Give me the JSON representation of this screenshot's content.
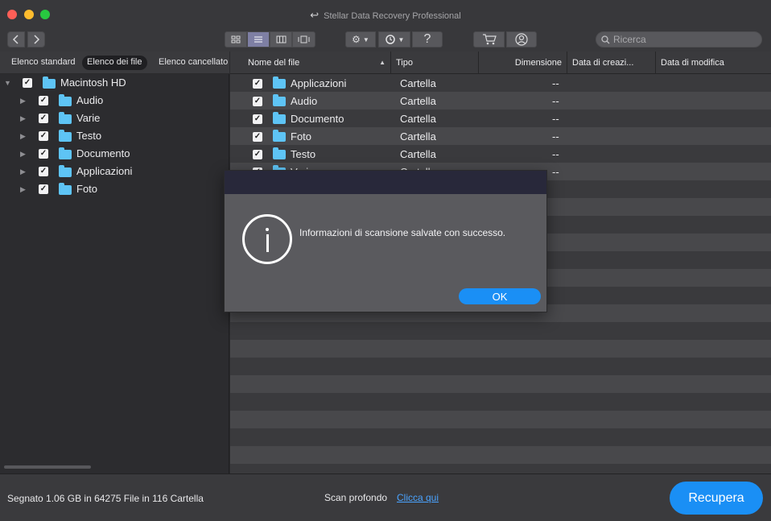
{
  "window": {
    "title": "Stellar Data Recovery Professional"
  },
  "toolbar": {
    "search_placeholder": "Ricerca",
    "help_label": "?"
  },
  "left_panel": {
    "tabs": [
      {
        "label": "Elenco standard",
        "active": false
      },
      {
        "label": "Elenco dei file",
        "active": true
      },
      {
        "label": "Elenco cancellato",
        "active": false
      }
    ],
    "tree": {
      "root": "Macintosh HD",
      "children": [
        "Audio",
        "Varie",
        "Testo",
        "Documento",
        "Applicazioni",
        "Foto"
      ]
    }
  },
  "file_list": {
    "columns": [
      "Nome del file",
      "Tipo",
      "Dimensione",
      "Data di creazi...",
      "Data di modifica"
    ],
    "rows": [
      {
        "name": "Applicazioni",
        "type": "Cartella",
        "size": "--"
      },
      {
        "name": "Audio",
        "type": "Cartella",
        "size": "--"
      },
      {
        "name": "Documento",
        "type": "Cartella",
        "size": "--"
      },
      {
        "name": "Foto",
        "type": "Cartella",
        "size": "--"
      },
      {
        "name": "Testo",
        "type": "Cartella",
        "size": "--"
      },
      {
        "name": "Varie",
        "type": "Cartella",
        "size": "--"
      }
    ]
  },
  "dialog": {
    "message": "Informazioni di scansione salvate con successo.",
    "ok_label": "OK"
  },
  "status_bar": {
    "summary": "Segnato 1.06 GB in 64275 File in 116 Cartella",
    "scan_label": "Scan profondo",
    "scan_link": "Clicca qui",
    "recover_label": "Recupera"
  },
  "colors": {
    "accent": "#1a8ff5",
    "folder": "#5ec4f5",
    "link": "#4aa3ff"
  }
}
